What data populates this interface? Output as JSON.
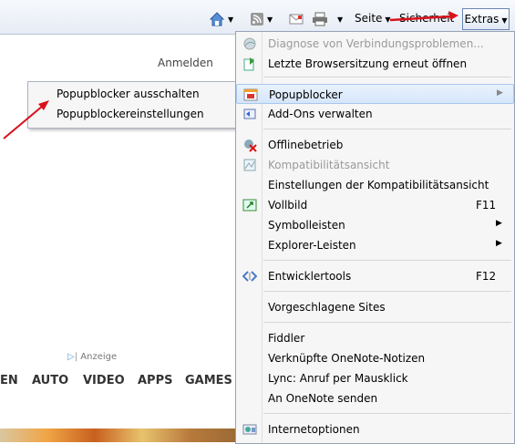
{
  "toolbar": {
    "seite_label": "Seite",
    "sicherheit_label": "Sicherheit",
    "extras_label": "Extras"
  },
  "page": {
    "anmelden": "Anmelden",
    "anzeige": "Anzeige",
    "nav": [
      "EN",
      "AUTO",
      "VIDEO",
      "APPS",
      "GAMES"
    ]
  },
  "submenu": {
    "items": [
      "Popupblocker ausschalten",
      "Popupblockereinstellungen"
    ]
  },
  "menu": {
    "items": [
      {
        "label": "Diagnose von Verbindungsproblemen...",
        "disabled": true,
        "icon": "diagnose-icon"
      },
      {
        "label": "Letzte Browsersitzung erneut öffnen",
        "icon": "reopen-session-icon"
      },
      {
        "label": "Popupblocker",
        "highlighted": true,
        "submenu": true,
        "icon": "popup-blocker-icon"
      },
      {
        "label": "Add-Ons verwalten",
        "icon": "addons-icon"
      },
      {
        "label": "Offlinebetrieb",
        "icon": "offline-icon"
      },
      {
        "label": "Kompatibilitätsansicht",
        "disabled": true,
        "icon": "compat-view-icon"
      },
      {
        "label": "Einstellungen der Kompatibilitätsansicht"
      },
      {
        "label": "Vollbild",
        "shortcut": "F11",
        "icon": "fullscreen-icon"
      },
      {
        "label": "Symbolleisten",
        "submenu": true
      },
      {
        "label": "Explorer-Leisten",
        "submenu": true
      },
      {
        "label": "Entwicklertools",
        "shortcut": "F12",
        "icon": "devtools-icon"
      },
      {
        "label": "Vorgeschlagene Sites"
      },
      {
        "label": "Fiddler"
      },
      {
        "label": "Verknüpfte OneNote-Notizen"
      },
      {
        "label": "Lync: Anruf per Mausklick"
      },
      {
        "label": "An OneNote senden"
      },
      {
        "label": "Internetoptionen",
        "icon": "internet-options-icon"
      }
    ],
    "submenu_arrow": "▶"
  },
  "colors": {
    "annotation_arrow": "#d9111b",
    "highlight": "#d6e6fb"
  }
}
